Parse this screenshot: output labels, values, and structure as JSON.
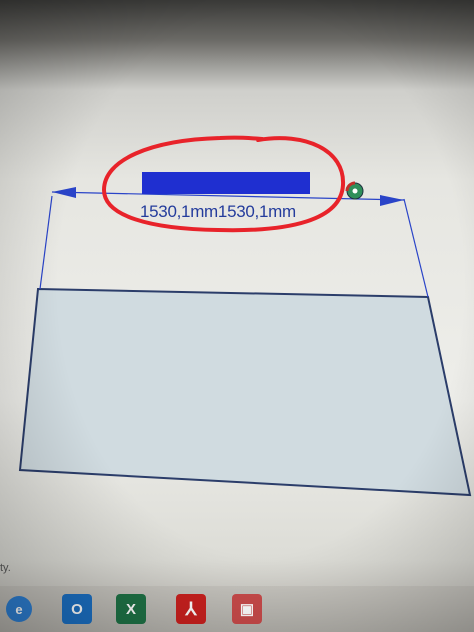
{
  "dimension": {
    "value_label": "1530,1mm1530,1mm",
    "input_value": ""
  },
  "status": {
    "text": "ty."
  },
  "taskbar": {
    "icons": [
      "internet-explorer-icon",
      "outlook-icon",
      "excel-icon",
      "acrobat-pdf-icon",
      "toolbox-icon"
    ],
    "ie_glyph": "e",
    "outlook_glyph": "O",
    "excel_glyph": "X",
    "pdf_glyph": "⅄",
    "box_glyph": "▣"
  },
  "colors": {
    "dimension_line": "#2a44c8",
    "highlight_input": "#1f2fd0",
    "red_annotation": "#e8232a",
    "shape_fill": "#d3dde2",
    "shape_stroke": "#2b3d6a"
  }
}
